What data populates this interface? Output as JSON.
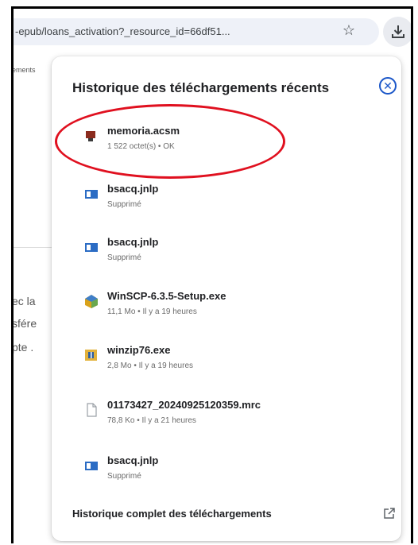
{
  "browser": {
    "url": "-epub/loans_activation?_resource_id=66df51...",
    "bookmark_icon": "star-icon",
    "download_icon": "download-icon"
  },
  "page_background": {
    "line1": "ements",
    "line2": "ec la",
    "line3": "sfére",
    "line4": "pte ."
  },
  "downloads_panel": {
    "title": "Historique des téléchargements récents",
    "close_icon": "close-icon",
    "items": [
      {
        "name": "memoria.acsm",
        "detail": "1 522 octet(s) • OK",
        "icon": "acsm-file-icon"
      },
      {
        "name": "bsacq.jnlp",
        "detail": "Supprimé",
        "icon": "jnlp-file-icon"
      },
      {
        "name": "bsacq.jnlp",
        "detail": "Supprimé",
        "icon": "jnlp-file-icon"
      },
      {
        "name": "WinSCP-6.3.5-Setup.exe",
        "detail": "11,1 Mo • Il y a 19 heures",
        "icon": "winscp-installer-icon"
      },
      {
        "name": "winzip76.exe",
        "detail": "2,8 Mo • Il y a 19 heures",
        "icon": "winzip-installer-icon"
      },
      {
        "name": "01173427_20240925120359.mrc",
        "detail": "78,8 Ko • Il y a 21 heures",
        "icon": "generic-file-icon"
      },
      {
        "name": "bsacq.jnlp",
        "detail": "Supprimé",
        "icon": "jnlp-file-icon"
      }
    ],
    "footer_link": "Historique complet des téléchargements",
    "footer_icon": "open-external-icon"
  },
  "colors": {
    "annotation_red": "#e0101f",
    "accent_blue": "#1a56c8"
  }
}
